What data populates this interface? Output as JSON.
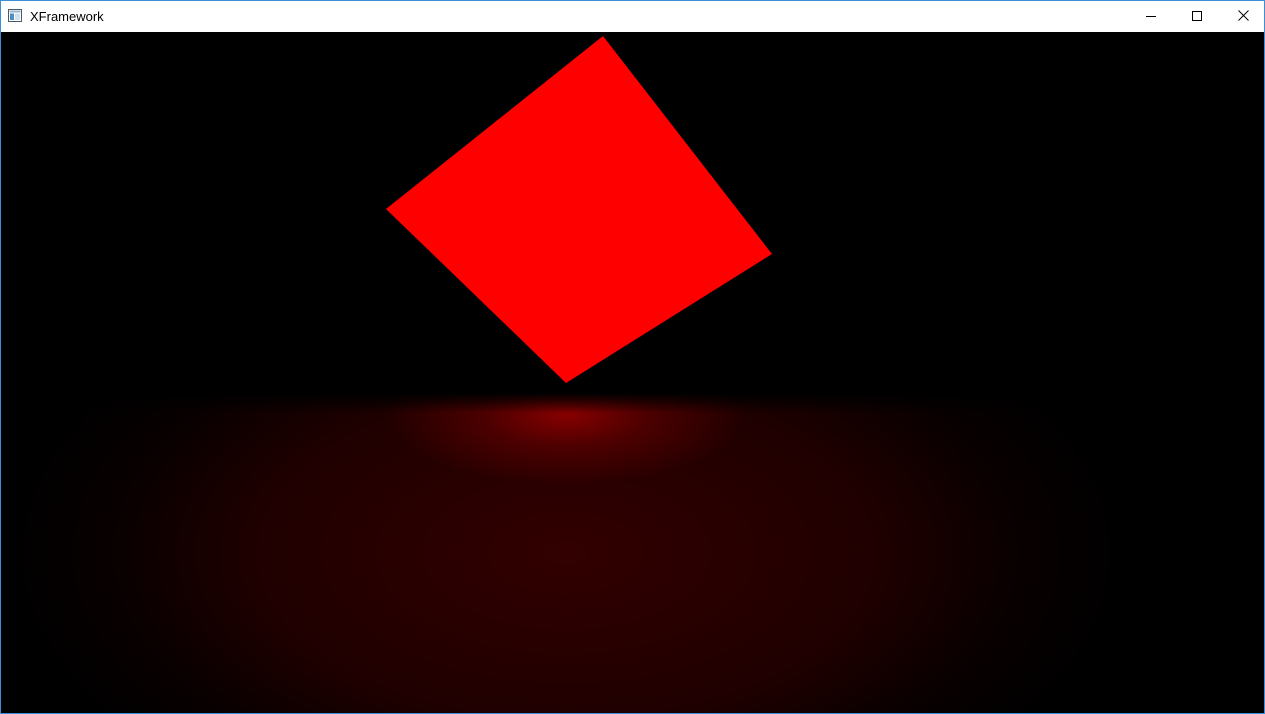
{
  "window": {
    "title": "XFramework",
    "controls": {
      "minimize": "minimize-icon",
      "maximize": "maximize-icon",
      "close": "close-icon"
    }
  },
  "scene": {
    "background_color": "#000000",
    "cube_color": "#ff0000",
    "floor_glow_color": "#8c0000"
  }
}
